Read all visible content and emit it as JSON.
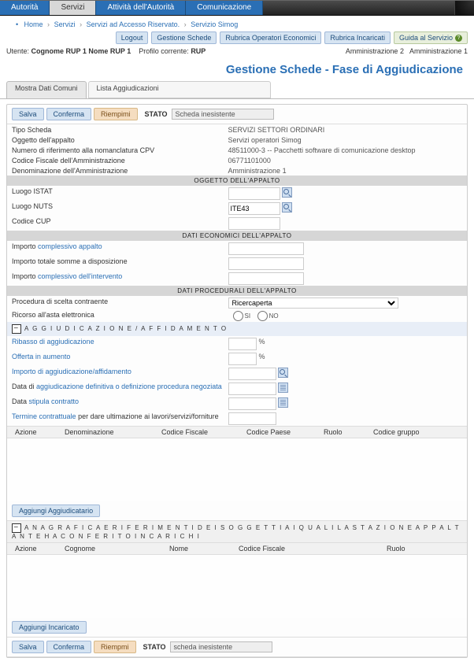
{
  "topTabs": [
    "Autorità",
    "Servizi",
    "Attività dell'Autorità",
    "Comunicazione"
  ],
  "activeTab": 1,
  "crumbs": {
    "home": "Home",
    "servizi": "Servizi",
    "riservato": "Servizi ad Accesso Riservato.",
    "simog": "Servizio Simog"
  },
  "user": {
    "utente": "Utente:",
    "nome": "Cognome RUP 1 Nome RUP 1",
    "profilo_lbl": "Profilo corrente:",
    "profilo": "RUP"
  },
  "rightAdmin": {
    "a": "Amministrazione 2",
    "b": "Amministrazione 1"
  },
  "toolbar": {
    "logout": "Logout",
    "schede": "Gestione Schede",
    "rubrica_oe": "Rubrica Operatori Economici",
    "rubrica_ic": "Rubrica Incaricati",
    "guida": "Guida al Servizio"
  },
  "pageTitle": "Gestione Schede - Fase di Aggiudicazione",
  "subtabs": {
    "mostra": "Mostra Dati Comuni",
    "lista": "Lista Aggiudicazioni"
  },
  "actions": {
    "salva": "Salva",
    "conferma": "Conferma",
    "riempimi": "Riempimi",
    "stato_lbl": "STATO",
    "stato_val": "Scheda inesistente"
  },
  "head1": {
    "tipo_lbl": "Tipo Scheda",
    "tipo_val": "SERVIZI SETTORI ORDINARI",
    "ogg_lbl": "Oggetto dell'appalto",
    "ogg_val": "Servizi operatori Simog",
    "num_lbl": "Numero di riferimento alla nomanclatura CPV",
    "num_val": "48511000-3 -- Pacchetti software di comunicazione desktop",
    "cf_lbl": "Codice Fiscale dell'Amministrazione",
    "cf_val": "06771101000",
    "den_lbl": "Denominazione dell'Amministrazione",
    "den_val": "Amministrazione 1"
  },
  "bar_oggetto": "OGGETTO DELL'APPALTO",
  "oggetto": {
    "istat": "Luogo ISTAT",
    "nuts": "Luogo NUTS",
    "nuts_val": "ITE43",
    "cup": "Codice CUP"
  },
  "bar_economici": "DATI ECONOMICI DELL'APPALTO",
  "econ": {
    "a": "Importo",
    "a2": "complessivo appalto",
    "b": "Importo totale somme a disposizione",
    "c": "Importo",
    "c2": "complessivo dell'intervento"
  },
  "bar_proced": "DATI PROCEDURALI DELL'APPALTO",
  "proced": {
    "scelta": "Procedura di scelta contraente",
    "scelta_val": "Ricercaperta",
    "asta": "Ricorso all'asta elettronica",
    "si": "SI",
    "no": "NO"
  },
  "aggHead": "A G G I U D I C A Z I O N E   /   A F F I D A M E N T O",
  "agg": {
    "ribasso": "Ribasso di aggiudicazione",
    "offerta": "Offerta in aumento",
    "importo": "Importo di aggiudicazione/affidamento",
    "data_agg": "Data di",
    "data_agg2": "aggiudicazione definitiva o definizione procedura negoziata",
    "data_stip": "Data",
    "data_stip2": "stipula contratto",
    "term": "Termine contrattuale",
    "term2": "per dare ultimazione ai lavori/servizi/forniture"
  },
  "grid1": {
    "azione": "Azione",
    "denom": "Denominazione",
    "cf": "Codice Fiscale",
    "cp": "Codice Paese",
    "ruolo": "Ruolo",
    "cg": "Codice gruppo"
  },
  "btn_agg": "Aggiungi Aggiudicatario",
  "anagHead": "A N A G R A F I C A  E  R I F E R I M E N T I  D E I  S O G G E T T I  A I  Q U A L I  L A  S T A Z I O N E  A P P A L T A N T E  H A  C O N F E R I T O  I N C A R I C H I",
  "grid2": {
    "azione": "Azione",
    "cognome": "Cognome",
    "nome": "Nome",
    "cf": "Codice Fiscale",
    "ruolo": "Ruolo"
  },
  "btn_inc": "Aggiungi Incaricato",
  "actions2": {
    "salva": "Salva",
    "conferma": "Conferma",
    "riempmi": "Riempmi",
    "stato_lbl": "STATO",
    "stato_val": "scheda inesistente"
  }
}
